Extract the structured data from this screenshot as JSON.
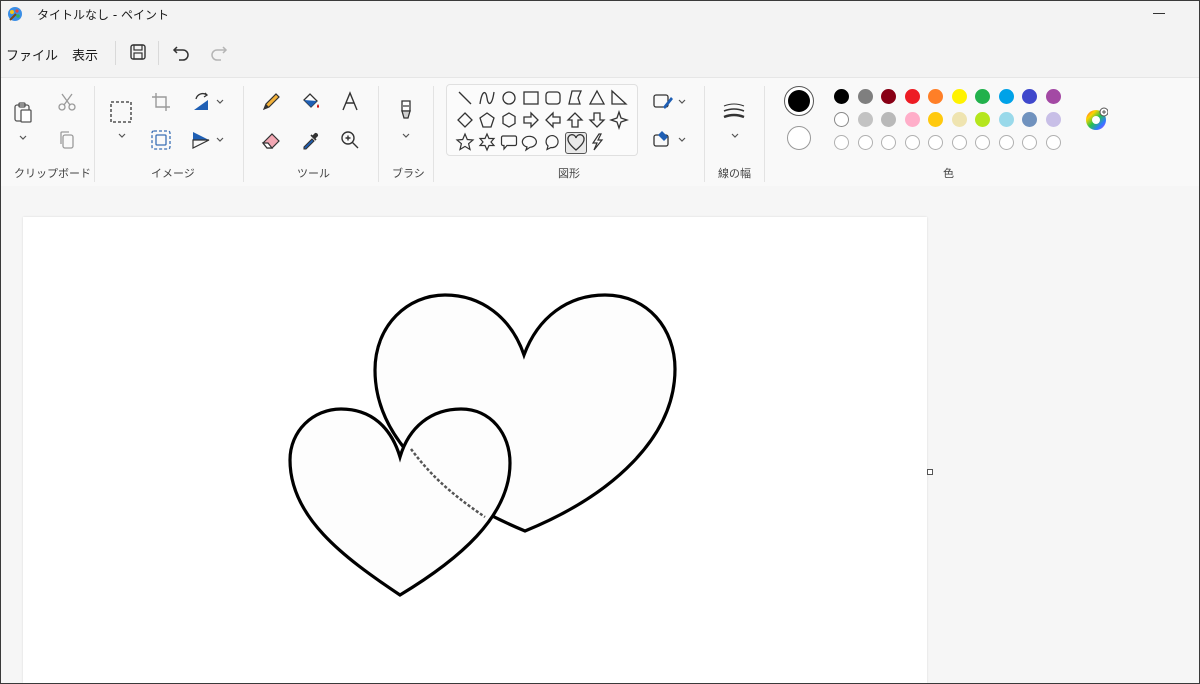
{
  "window": {
    "title": "タイトルなし - ペイント"
  },
  "menu": {
    "file": "ファイル",
    "view": "表示"
  },
  "groups": {
    "clipboard": "クリップボード",
    "image": "イメージ",
    "tools": "ツール",
    "brush": "ブラシ",
    "shapes": "図形",
    "stroke_width": "線の幅",
    "colors": "色"
  },
  "colors": {
    "primary": "#000000",
    "secondary": "#ffffff",
    "palette_row1": [
      "#000000",
      "#7f7f7f",
      "#880015",
      "#ed1c24",
      "#ff7f27",
      "#fff200",
      "#22b14c",
      "#00a2e8",
      "#3f48cc",
      "#a349a4"
    ],
    "palette_row2": [
      "#ffffff",
      "#c3c3c3",
      "#b9b9b9",
      "#ffaec9",
      "#ffc90e",
      "#efe4b0",
      "#b5e61d",
      "#99d9ea",
      "#7092be",
      "#c8bfe7"
    ],
    "palette_row3_empty": 10
  },
  "shapes": [
    "line",
    "curve",
    "oval",
    "rectangle",
    "rounded-rectangle",
    "polygon",
    "triangle",
    "right-triangle",
    "diamond",
    "pentagon",
    "hexagon",
    "right-arrow",
    "left-arrow",
    "up-arrow",
    "down-arrow",
    "four-point-star",
    "five-point-star",
    "six-point-star",
    "rounded-callout",
    "oval-callout",
    "cloud-callout",
    "heart",
    "lightning"
  ],
  "selected_shape": "heart"
}
